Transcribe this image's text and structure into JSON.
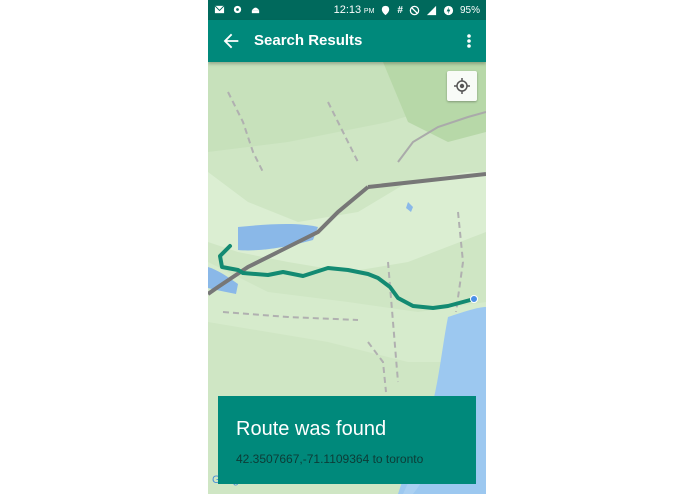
{
  "status_bar": {
    "time": "12:13",
    "ampm": "PM",
    "battery": "95%"
  },
  "app_bar": {
    "title": "Search Results",
    "back_icon": "arrow-back-icon",
    "menu_icon": "more-vert-icon"
  },
  "map": {
    "locate_icon": "my-location-icon",
    "watermark": "Google",
    "route_color": "#138a72"
  },
  "result_card": {
    "title": "Route was found",
    "subtitle": "42.3507667,-71.1109364 to toronto"
  },
  "colors": {
    "primary": "#00897b",
    "primary_dark": "#00695c"
  }
}
